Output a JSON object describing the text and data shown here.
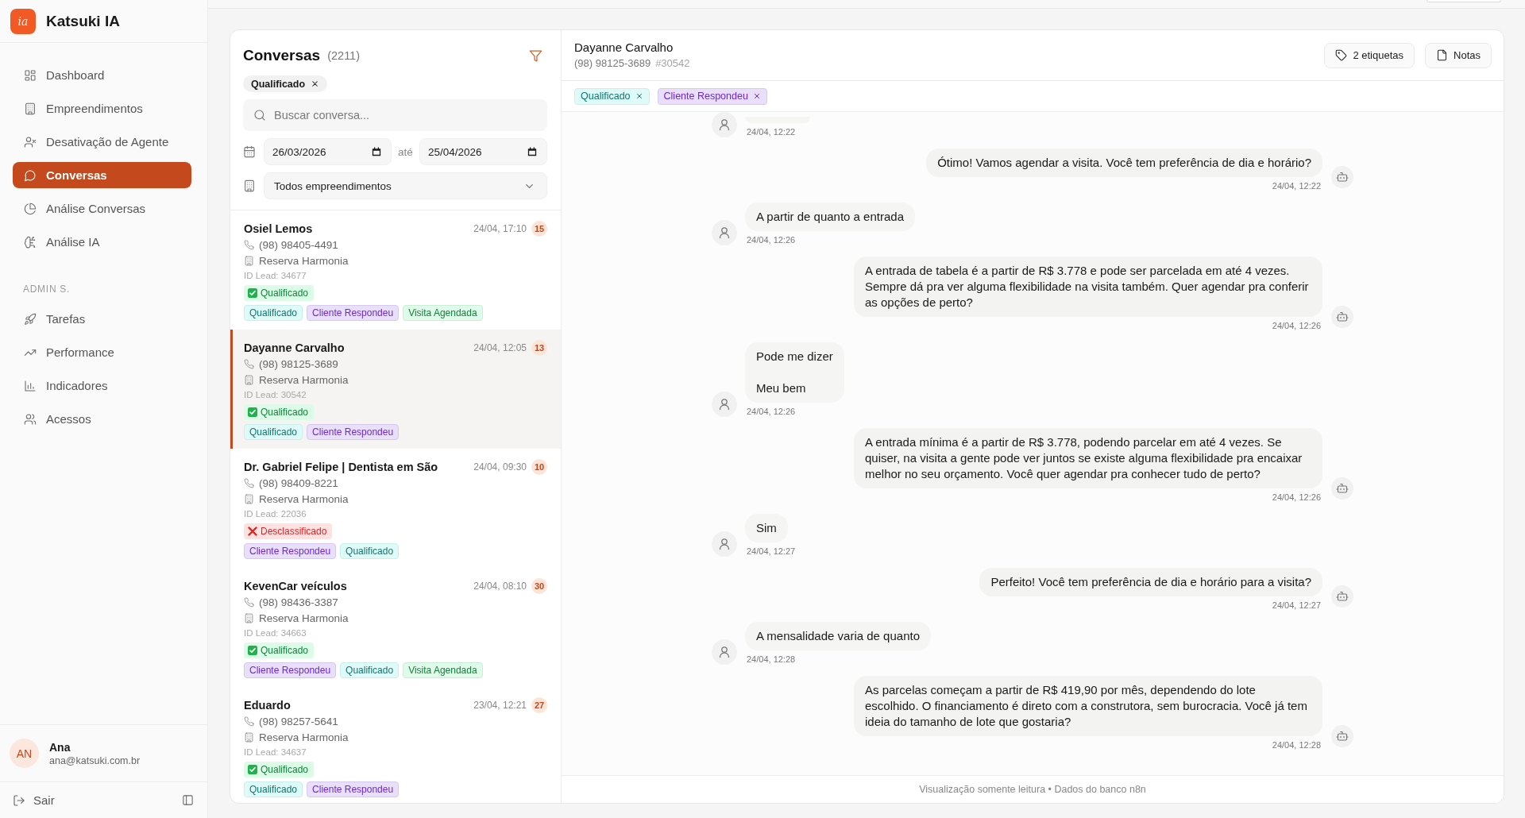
{
  "sidebar": {
    "logo_text": "ia",
    "brand": "Katsuki IA",
    "nav": [
      {
        "label": "Dashboard",
        "selected": false
      },
      {
        "label": "Empreendimentos",
        "selected": false
      },
      {
        "label": "Desativação de Agente",
        "selected": false
      },
      {
        "label": "Conversas",
        "selected": true
      },
      {
        "label": "Análise Conversas",
        "selected": false
      },
      {
        "label": "Análise IA",
        "selected": false
      }
    ],
    "section": {
      "title": "ADMIN S.",
      "items": [
        {
          "label": "Tarefas",
          "selected": false
        },
        {
          "label": "Performance",
          "selected": false
        },
        {
          "label": "Indicadores",
          "selected": false
        },
        {
          "label": "Acessos",
          "selected": false
        }
      ]
    },
    "user": {
      "initials": "AN",
      "name": "Ana",
      "email": "ana@katsuki.com.br"
    },
    "logout": "Sair"
  },
  "list": {
    "title": "Conversas",
    "count": "(2211)",
    "active_filter": {
      "label": "Qualificado"
    },
    "search": {
      "placeholder": "Buscar conversa..."
    },
    "date_from": "26/03/2026",
    "date_separator": "até",
    "date_to": "25/04/2026",
    "project_select": "Todos empreendimentos",
    "conversations": [
      {
        "name": "Osiel Lemos",
        "time": "24/04, 17:10",
        "count": "15",
        "phone": "(98) 98405-4491",
        "project": "Reserva Harmonia",
        "lead_id": "ID Lead: 34677",
        "status": {
          "kind": "qualified",
          "label": "Qualificado"
        },
        "tags": [
          {
            "label": "Qualificado",
            "color": "#0f766e"
          },
          {
            "label": "Cliente Respondeu",
            "color": "#6d28d9"
          },
          {
            "label": "Visita Agendada",
            "color": "#15803d"
          }
        ],
        "selected": false
      },
      {
        "name": "Dayanne Carvalho",
        "time": "24/04, 12:05",
        "count": "13",
        "phone": "(98) 98125-3689",
        "project": "Reserva Harmonia",
        "lead_id": "ID Lead: 30542",
        "status": {
          "kind": "qualified",
          "label": "Qualificado"
        },
        "tags": [
          {
            "label": "Qualificado",
            "color": "#0f766e"
          },
          {
            "label": "Cliente Respondeu",
            "color": "#6d28d9"
          }
        ],
        "selected": true
      },
      {
        "name": "Dr. Gabriel Felipe | Dentista em São",
        "time": "24/04, 09:30",
        "count": "10",
        "phone": "(98) 98409-8221",
        "project": "Reserva Harmonia",
        "lead_id": "ID Lead: 22036",
        "status": {
          "kind": "disqualified",
          "label": "Desclassificado"
        },
        "tags": [
          {
            "label": "Cliente Respondeu",
            "color": "#6d28d9"
          },
          {
            "label": "Qualificado",
            "color": "#0f766e"
          }
        ],
        "selected": false
      },
      {
        "name": "KevenCar veículos",
        "time": "24/04, 08:10",
        "count": "30",
        "phone": "(98) 98436-3387",
        "project": "Reserva Harmonia",
        "lead_id": "ID Lead: 34663",
        "status": {
          "kind": "qualified",
          "label": "Qualificado"
        },
        "tags": [
          {
            "label": "Cliente Respondeu",
            "color": "#6d28d9"
          },
          {
            "label": "Qualificado",
            "color": "#0f766e"
          },
          {
            "label": "Visita Agendada",
            "color": "#15803d"
          }
        ],
        "selected": false
      },
      {
        "name": "Eduardo",
        "time": "23/04, 12:21",
        "count": "27",
        "phone": "(98) 98257-5641",
        "project": "Reserva Harmonia",
        "lead_id": "ID Lead: 34637",
        "status": {
          "kind": "qualified",
          "label": "Qualificado"
        },
        "tags": [
          {
            "label": "Qualificado",
            "color": "#0f766e"
          },
          {
            "label": "Cliente Respondeu",
            "color": "#6d28d9"
          }
        ],
        "selected": false
      }
    ]
  },
  "chat": {
    "name": "Dayanne Carvalho",
    "phone": "(98) 98125-3689",
    "lead_ref": "#30542",
    "buttons": [
      {
        "label": "2 etiquetas"
      },
      {
        "label": "Notas"
      }
    ],
    "tags": [
      {
        "label": "Qualificado",
        "color": "#0f766e"
      },
      {
        "label": "Cliente Respondeu",
        "color": "#6d28d9"
      }
    ],
    "messages": [
      {
        "kind": "customer",
        "time": "24/04, 12:22"
      },
      {
        "kind": "bot",
        "text": "Ótimo! Vamos agendar a visita. Você tem preferência de dia e horário?",
        "time": "24/04, 12:22"
      },
      {
        "kind": "customer",
        "text": "A partir de quanto a entrada",
        "time": "24/04, 12:26"
      },
      {
        "kind": "bot",
        "text": "A entrada de tabela é a partir de R$ 3.778 e pode ser parcelada em até 4 vezes. Sempre dá pra ver alguma flexibilidade na visita também. Quer agendar pra conferir as opções de perto?",
        "time": "24/04, 12:26"
      },
      {
        "kind": "customer",
        "text": "Pode me dizer\n\nMeu bem",
        "time": "24/04, 12:26"
      },
      {
        "kind": "bot",
        "text": "A entrada mínima é a partir de R$ 3.778, podendo parcelar em até 4 vezes. Se quiser, na visita a gente pode ver juntos se existe alguma flexibilidade pra encaixar melhor no seu orçamento. Você quer agendar pra conhecer tudo de perto?",
        "time": "24/04, 12:26"
      },
      {
        "kind": "customer",
        "text": "Sim",
        "time": "24/04, 12:27"
      },
      {
        "kind": "bot",
        "text": "Perfeito! Você tem preferência de dia e horário para a visita?",
        "time": "24/04, 12:27"
      },
      {
        "kind": "customer",
        "text": "A mensalidade varia de quanto",
        "time": "24/04, 12:28"
      },
      {
        "kind": "bot",
        "text": "As parcelas começam a partir de R$ 419,90 por mês, dependendo do lote escolhido. O financiamento é direto com a construtora, sem burocracia. Você já tem ideia do tamanho de lote que gostaria?",
        "time": "24/04, 12:28"
      }
    ],
    "footer": "Visualização somente leitura • Dados do banco n8n"
  }
}
